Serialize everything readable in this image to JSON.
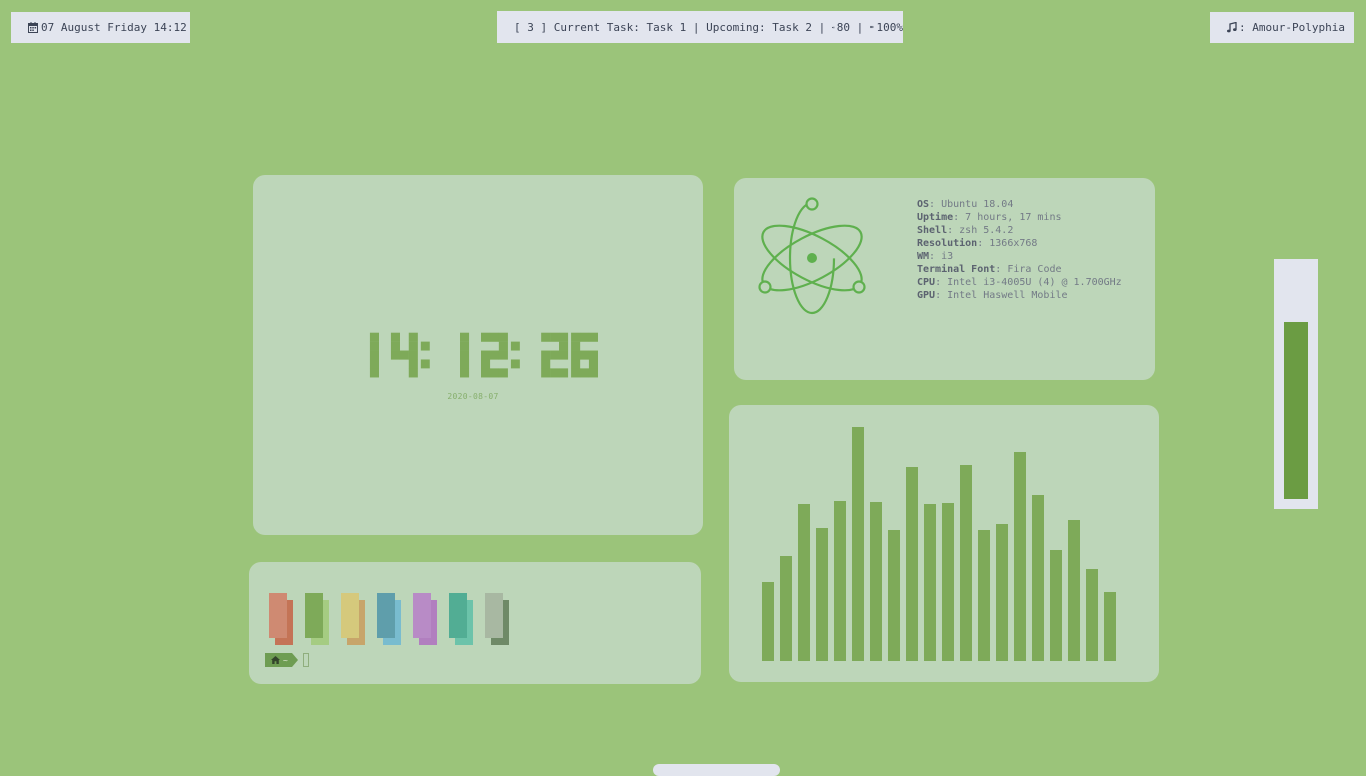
{
  "topbar": {
    "left": {
      "icon": "calendar-icon",
      "text": "07 August Friday 14:12"
    },
    "center": {
      "workspace": "[ 3 ]",
      "current_task": "Current Task: Task 1",
      "upcoming_task": "Upcoming: Task 2",
      "volume_icon": "speaker-icon",
      "volume": "80",
      "battery_icon": "battery-icon",
      "battery": "100%"
    },
    "right": {
      "icon": "music-note-icon",
      "text": ": Amour-Polyphia"
    }
  },
  "clock": {
    "time": "14:12:26",
    "date": "2020-08-07",
    "color": "#7eaa59"
  },
  "sysinfo": {
    "logo": "electron-atom-icon",
    "items": [
      {
        "key": "OS",
        "value": ": Ubuntu 18.04"
      },
      {
        "key": "Uptime",
        "value": ": 7 hours, 17 mins"
      },
      {
        "key": "Shell",
        "value": ": zsh 5.4.2"
      },
      {
        "key": "Resolution",
        "value": ": 1366x768"
      },
      {
        "key": "WM",
        "value": ": i3"
      },
      {
        "key": "Terminal Font",
        "value": ": Fira Code"
      },
      {
        "key": "CPU",
        "value": ": Intel i3-4005U (4) @ 1.700GHz"
      },
      {
        "key": "GPU",
        "value": ": Intel Haswell Mobile"
      }
    ]
  },
  "terminal": {
    "swatches": [
      {
        "name": "red",
        "dark": "#cf8a72",
        "light": "#c47456"
      },
      {
        "name": "green",
        "dark": "#7eaa59",
        "light": "#a5cc82"
      },
      {
        "name": "yellow",
        "dark": "#d5c97c",
        "light": "#c7a56a"
      },
      {
        "name": "blue",
        "dark": "#5f9eab",
        "light": "#79bccf"
      },
      {
        "name": "magenta",
        "dark": "#b88bc6",
        "light": "#b17fbf"
      },
      {
        "name": "cyan",
        "dark": "#52ad94",
        "light": "#6cc3aa"
      },
      {
        "name": "white",
        "dark": "#a8b8a2",
        "light": "#6f8a67"
      }
    ],
    "prompt_icon": "home-icon",
    "prompt_dir": "~"
  },
  "visualizer": {
    "chart_data": {
      "type": "bar",
      "values": [
        79,
        105,
        157,
        133,
        160,
        234,
        159,
        131,
        194,
        157,
        158,
        196,
        131,
        137,
        209,
        166,
        111,
        141,
        92,
        69
      ],
      "ylim": [
        0,
        240
      ],
      "color": "#7eaa59"
    }
  },
  "volume_meter": {
    "level": 0.77,
    "color": "#6b9c43"
  }
}
